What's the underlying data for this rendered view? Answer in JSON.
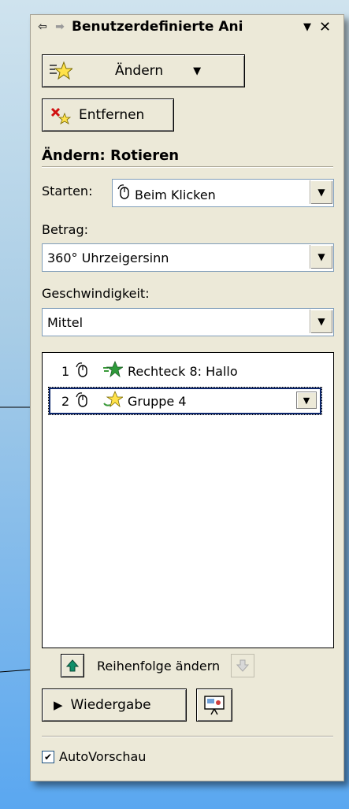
{
  "panel": {
    "title": "Benutzerdefinierte Ani",
    "nav_back": "⇦",
    "nav_forward": "➡",
    "dropdown_glyph": "▼",
    "close_glyph": "✕"
  },
  "toolbar": {
    "change_label": "Ändern",
    "remove_label": "Entfernen"
  },
  "section": {
    "heading": "Ändern: Rotieren"
  },
  "fields": {
    "start_label": "Starten:",
    "start_value": "Beim Klicken",
    "amount_label": "Betrag:",
    "amount_value": "360° Uhrzeigersinn",
    "speed_label": "Geschwindigkeit:",
    "speed_value": "Mittel"
  },
  "animation_list": [
    {
      "number": "1",
      "name": "Rechteck 8: Hallo",
      "selected": false
    },
    {
      "number": "2",
      "name": "Gruppe 4",
      "selected": true
    }
  ],
  "order": {
    "label": "Reihenfolge ändern"
  },
  "playback": {
    "play_label": "Wiedergabe",
    "slideshow_icon": "slideshow-icon"
  },
  "autopreview": {
    "label": "AutoVorschau",
    "checked": true
  },
  "colors": {
    "panel_bg": "#ece9d8",
    "selection_border": "#0a246a",
    "arrow_accent": "#0f8f6a"
  }
}
